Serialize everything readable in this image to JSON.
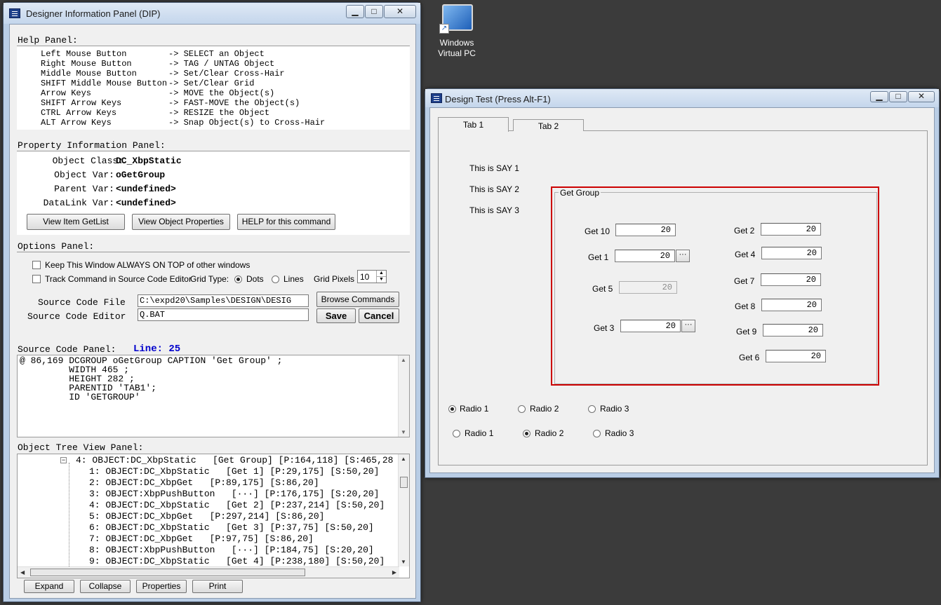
{
  "desktop": {
    "icon_label_line1": "Windows",
    "icon_label_line2": "Virtual PC"
  },
  "dip": {
    "title": "Designer Information Panel (DIP)",
    "help_title": "Help Panel:",
    "help_rows": [
      {
        "key": "Left Mouse Button",
        "action": "-> SELECT an Object"
      },
      {
        "key": "Right Mouse Button",
        "action": "-> TAG / UNTAG Object"
      },
      {
        "key": "Middle Mouse Button",
        "action": "-> Set/Clear Cross-Hair"
      },
      {
        "key": "SHIFT Middle Mouse Button",
        "action": "-> Set/Clear Grid"
      },
      {
        "key": "Arrow Keys",
        "action": "-> MOVE the Object(s)"
      },
      {
        "key": "SHIFT Arrow Keys",
        "action": "-> FAST-MOVE the Object(s)"
      },
      {
        "key": "CTRL Arrow Keys",
        "action": "-> RESIZE the Object"
      },
      {
        "key": "ALT Arrow Keys",
        "action": "-> Snap Object(s) to Cross-Hair"
      }
    ],
    "prop_title": "Property Information Panel:",
    "prop": {
      "class_label": "Object Class:",
      "class_value": "DC_XbpStatic",
      "var_label": "Object Var:",
      "var_value": "oGetGroup",
      "parent_label": "Parent Var:",
      "parent_value": "<undefined>",
      "datalink_label": "DataLink Var:",
      "datalink_value": "<undefined>"
    },
    "prop_buttons": {
      "getlist": "View Item GetList",
      "props": "View Object Properties",
      "help": "HELP for this command"
    },
    "options_title": "Options Panel:",
    "options": {
      "keep_on_top": "Keep This Window ALWAYS ON TOP of other windows",
      "track_cmd": "Track Command in Source Code Editor",
      "grid_type": "Grid Type:",
      "dots": "Dots",
      "lines": "Lines",
      "grid_pixels": "Grid Pixels",
      "grid_pixels_value": "10",
      "source_file_label": "Source Code File",
      "source_file_value": "C:\\expd20\\Samples\\DESIGN\\DESIG",
      "editor_label": "Source Code Editor",
      "editor_value": "Q.BAT",
      "browse": "Browse Commands",
      "save": "Save",
      "cancel": "Cancel"
    },
    "source_title": "Source Code Panel:",
    "source_line": "Line: 25",
    "source_code": "@ 86,169 DCGROUP oGetGroup CAPTION 'Get Group' ;\n         WIDTH 465 ;\n         HEIGHT 282 ;\n         PARENTID 'TAB1';\n         ID 'GETGROUP'",
    "tree_title": "Object Tree View Panel:",
    "tree_rows": [
      "4: OBJECT:DC_XbpStatic   [Get Group] [P:164,118] [S:465,28",
      "1: OBJECT:DC_XbpStatic   [Get 1] [P:29,175] [S:50,20]",
      "2: OBJECT:DC_XbpGet   [P:89,175] [S:86,20]",
      "3: OBJECT:XbpPushButton   [···] [P:176,175] [S:20,20]",
      "4: OBJECT:DC_XbpStatic   [Get 2] [P:237,214] [S:50,20]",
      "5: OBJECT:DC_XbpGet   [P:297,214] [S:86,20]",
      "6: OBJECT:DC_XbpStatic   [Get 3] [P:37,75] [S:50,20]",
      "7: OBJECT:DC_XbpGet   [P:97,75] [S:86,20]",
      "8: OBJECT:XbpPushButton   [···] [P:184,75] [S:20,20]",
      "9: OBJECT:DC_XbpStatic   [Get 4] [P:238,180] [S:50,20]"
    ],
    "tree_buttons": {
      "expand": "Expand",
      "collapse": "Collapse",
      "properties": "Properties",
      "print": "Print"
    }
  },
  "design": {
    "title": "Design Test (Press Alt-F1)",
    "tab1": "Tab 1",
    "tab2": "Tab 2",
    "say1": "This is SAY 1",
    "say2": "This is SAY 2",
    "say3": "This is SAY 3",
    "group_caption": "Get Group",
    "gets": {
      "get10_label": "Get 10",
      "get10_value": "20",
      "get1_label": "Get 1",
      "get1_value": "20",
      "get5_label": "Get 5",
      "get5_value": "20",
      "get3_label": "Get 3",
      "get3_value": "20",
      "get2_label": "Get 2",
      "get2_value": "20",
      "get4_label": "Get 4",
      "get4_value": "20",
      "get7_label": "Get 7",
      "get7_value": "20",
      "get8_label": "Get 8",
      "get8_value": "20",
      "get9_label": "Get 9",
      "get9_value": "20",
      "get6_label": "Get 6",
      "get6_value": "20"
    },
    "ellipsis": "···",
    "radios_a": {
      "r1": "Radio 1",
      "r2": "Radio 2",
      "r3": "Radio 3"
    },
    "radios_b": {
      "r1": "Radio 1",
      "r2": "Radio 2",
      "r3": "Radio 3"
    }
  },
  "colors": {
    "selection_border": "#cc0000",
    "line_number": "#0000cc"
  }
}
